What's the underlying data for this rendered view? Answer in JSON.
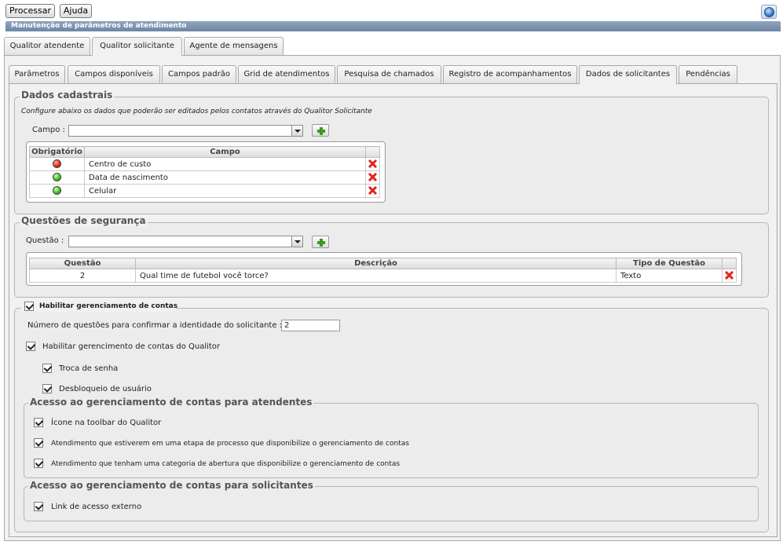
{
  "toolbar": {
    "process_label": "Processar",
    "help_label": "Ajuda"
  },
  "window_title": "Manutenção de parâmetros de atendimento",
  "main_tabs": [
    "Qualitor atendente",
    "Qualitor solicitante",
    "Agente de mensagens"
  ],
  "sub_tabs": [
    "Parâmetros",
    "Campos disponíveis",
    "Campos padrão",
    "Grid de atendimentos",
    "Pesquisa de chamados",
    "Registro de acompanhamentos",
    "Dados de solicitantes",
    "Pendências"
  ],
  "dados_cadastrais": {
    "legend": "Dados cadastrais",
    "description": "Configure abaixo os dados que poderão ser editados pelos contatos através do Qualitor Solicitante",
    "campo_label": "Campo :",
    "campo_value": "",
    "columns": [
      "Obrigatório",
      "Campo"
    ],
    "rows": [
      {
        "required_status": "red",
        "campo": "Centro de custo"
      },
      {
        "required_status": "green",
        "campo": "Data de nascimento"
      },
      {
        "required_status": "green",
        "campo": "Celular"
      }
    ]
  },
  "questoes": {
    "legend": "Questões de segurança",
    "questao_label": "Questão :",
    "questao_value": "",
    "columns": [
      "Questão",
      "Descrição",
      "Tipo de Questão"
    ],
    "rows": [
      {
        "questao": "2",
        "descricao": "Qual time de futebol você torce?",
        "tipo": "Texto"
      }
    ]
  },
  "gerenciamento": {
    "legend": "Habilitar gerenciamento de contas",
    "num_questoes_label": "Número de questões para confirmar a identidade do solicitante :",
    "num_questoes_value": "2",
    "qualitor_label": "Habilitar gerencimento de contas do Qualitor",
    "troca_senha_label": "Troca de senha",
    "desbloqueio_label": "Desbloqueio de usuário"
  },
  "acesso_atendentes": {
    "legend": "Acesso ao gerenciamento de contas para atendentes",
    "items": [
      "Ícone na toolbar do Qualitor",
      "Atendimento que estiverem em uma etapa de processo que disponibilize o gerenciamento de contas",
      "Atendimento que tenham uma categoria de abertura que disponibilize o gerenciamento de contas"
    ]
  },
  "acesso_solicitantes": {
    "legend": "Acesso ao gerenciamento de contas para solicitantes",
    "items": [
      "Link de acesso externo"
    ]
  }
}
